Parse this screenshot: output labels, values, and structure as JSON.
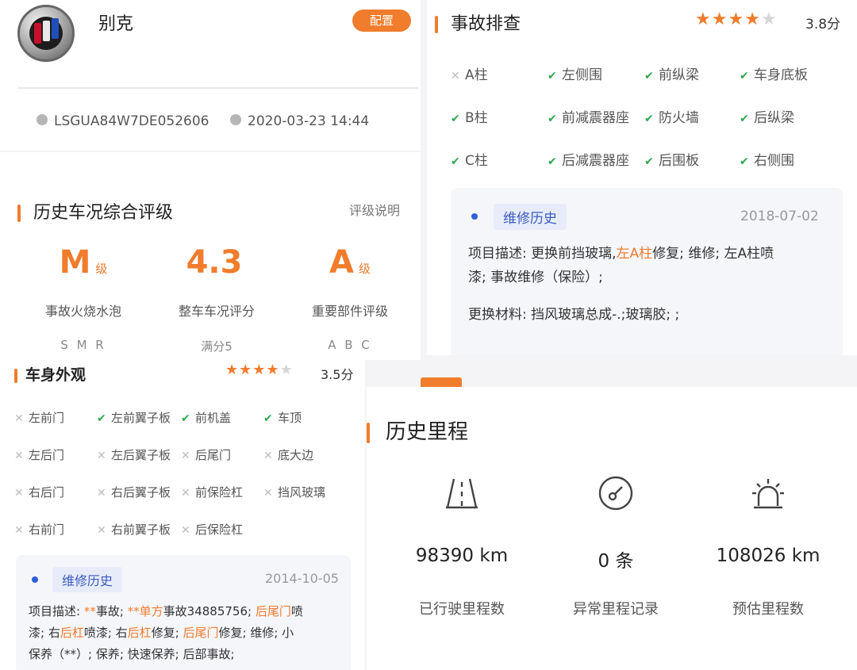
{
  "brand": {
    "name": "别克",
    "config_label": "配置",
    "vin": "LSGUA84W7DE052606",
    "datetime": "2020-03-23 14:44"
  },
  "rating": {
    "title": "历史车况综合评级",
    "link": "评级说明",
    "grades": [
      {
        "value": "M",
        "unit": "级",
        "label": "事故火烧水泡",
        "sub": "S M R"
      },
      {
        "value": "4.3",
        "unit": "",
        "label": "整车车况评分",
        "sub": "满分5"
      },
      {
        "value": "A",
        "unit": "级",
        "label": "重要部件评级",
        "sub": "A B C"
      }
    ]
  },
  "body": {
    "title": "车身外观",
    "stars": 3.5,
    "score": "3.5分",
    "items": [
      {
        "label": "左前门",
        "ok": false
      },
      {
        "label": "左前翼子板",
        "ok": true
      },
      {
        "label": "前机盖",
        "ok": true
      },
      {
        "label": "车顶",
        "ok": true
      },
      {
        "label": "左后门",
        "ok": false
      },
      {
        "label": "左后翼子板",
        "ok": false
      },
      {
        "label": "后尾门",
        "ok": false
      },
      {
        "label": "底大边",
        "ok": false
      },
      {
        "label": "右后门",
        "ok": false
      },
      {
        "label": "右后翼子板",
        "ok": false
      },
      {
        "label": "前保险杠",
        "ok": false
      },
      {
        "label": "挡风玻璃",
        "ok": false
      },
      {
        "label": "右前门",
        "ok": false
      },
      {
        "label": "右前翼子板",
        "ok": false
      },
      {
        "label": "后保险杠",
        "ok": false
      }
    ],
    "repair": {
      "tag": "维修历史",
      "date": "2014-10-05",
      "lines": [
        [
          [
            "项目描述: ",
            false
          ],
          [
            "**",
            true
          ],
          [
            "事故; ",
            false
          ],
          [
            "**单方",
            true
          ],
          [
            "事故34885756; ",
            false
          ],
          [
            "后尾门",
            true
          ],
          [
            "喷",
            false
          ]
        ],
        [
          [
            "漆; 右",
            false
          ],
          [
            "后杠",
            true
          ],
          [
            "喷漆; 右",
            false
          ],
          [
            "后杠",
            true
          ],
          [
            "修复; ",
            false
          ],
          [
            "后尾门",
            true
          ],
          [
            "修复; 维修; 小",
            false
          ]
        ],
        [
          [
            "保养（**）; 保养; 快速保养; 后部事故;",
            false
          ]
        ]
      ]
    }
  },
  "accident": {
    "title": "事故排查",
    "stars": 3.8,
    "score": "3.8分",
    "items": [
      {
        "label": "A柱",
        "ok": false
      },
      {
        "label": "左侧围",
        "ok": true
      },
      {
        "label": "前纵梁",
        "ok": true
      },
      {
        "label": "车身底板",
        "ok": true
      },
      {
        "label": "B柱",
        "ok": true
      },
      {
        "label": "前减震器座",
        "ok": true
      },
      {
        "label": "防火墙",
        "ok": true
      },
      {
        "label": "后纵梁",
        "ok": true
      },
      {
        "label": "C柱",
        "ok": true
      },
      {
        "label": "后减震器座",
        "ok": true
      },
      {
        "label": "后围板",
        "ok": true
      },
      {
        "label": "右侧围",
        "ok": true
      }
    ],
    "repair": {
      "tag": "维修历史",
      "date": "2018-07-02",
      "lines": [
        [
          [
            "项目描述: 更换前挡玻璃,",
            false
          ],
          [
            "左A柱",
            true
          ],
          [
            "修复; 维修; 左A柱喷",
            false
          ]
        ],
        [
          [
            "漆; 事故维修（保险）;",
            false
          ]
        ],
        [
          [
            "",
            false
          ]
        ],
        [
          [
            "更换材料: 挡风玻璃总成-.;玻璃胶; ;",
            false
          ]
        ]
      ]
    }
  },
  "mileage": {
    "title": "历史里程",
    "cols": [
      {
        "icon": "road-icon",
        "value": "98390 km",
        "label": "已行驶里程数"
      },
      {
        "icon": "gauge-icon",
        "value": "0 条",
        "label": "异常里程记录"
      },
      {
        "icon": "alarm-light-icon",
        "value": "108026 km",
        "label": "预估里程数"
      }
    ]
  },
  "colors": {
    "accent": "#f07c2c",
    "ok": "#2fa84f",
    "tag_blue": "#3a5bbf"
  }
}
